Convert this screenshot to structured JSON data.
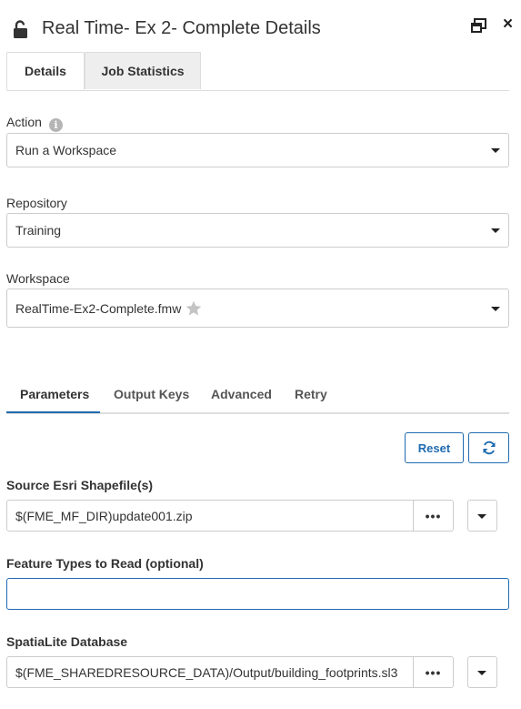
{
  "header": {
    "title": "Real Time- Ex 2- Complete Details",
    "icons": {
      "lock": "unlock-icon",
      "popout": "popout-window-icon",
      "close": "close-icon"
    },
    "close_glyph": "×"
  },
  "tabs": [
    {
      "label": "Details",
      "active": true
    },
    {
      "label": "Job Statistics",
      "active": false
    }
  ],
  "form": {
    "action": {
      "label": "Action",
      "value": "Run a Workspace",
      "info_glyph": "i"
    },
    "repository": {
      "label": "Repository",
      "value": "Training"
    },
    "workspace": {
      "label": "Workspace",
      "value": "RealTime-Ex2-Complete.fmw"
    }
  },
  "subtabs": [
    {
      "label": "Parameters",
      "active": true
    },
    {
      "label": "Output Keys",
      "active": false
    },
    {
      "label": "Advanced",
      "active": false
    },
    {
      "label": "Retry",
      "active": false
    }
  ],
  "buttons": {
    "reset": "Reset",
    "refresh_icon": "refresh-icon"
  },
  "parameters": {
    "source": {
      "label": "Source Esri Shapefile(s)",
      "value": "$(FME_MF_DIR)update001.zip",
      "browse": "•••"
    },
    "feature_types": {
      "label": "Feature Types to Read (optional)",
      "value": ""
    },
    "spatialite": {
      "label": "SpatiaLite Database",
      "value": "$(FME_SHAREDRESOURCE_DATA)/Output/building_footprints.sl3",
      "browse": "•••"
    }
  },
  "colors": {
    "accent": "#1f6bb0",
    "tab_inactive_bg": "#eeeeee",
    "border": "#cccccc"
  }
}
